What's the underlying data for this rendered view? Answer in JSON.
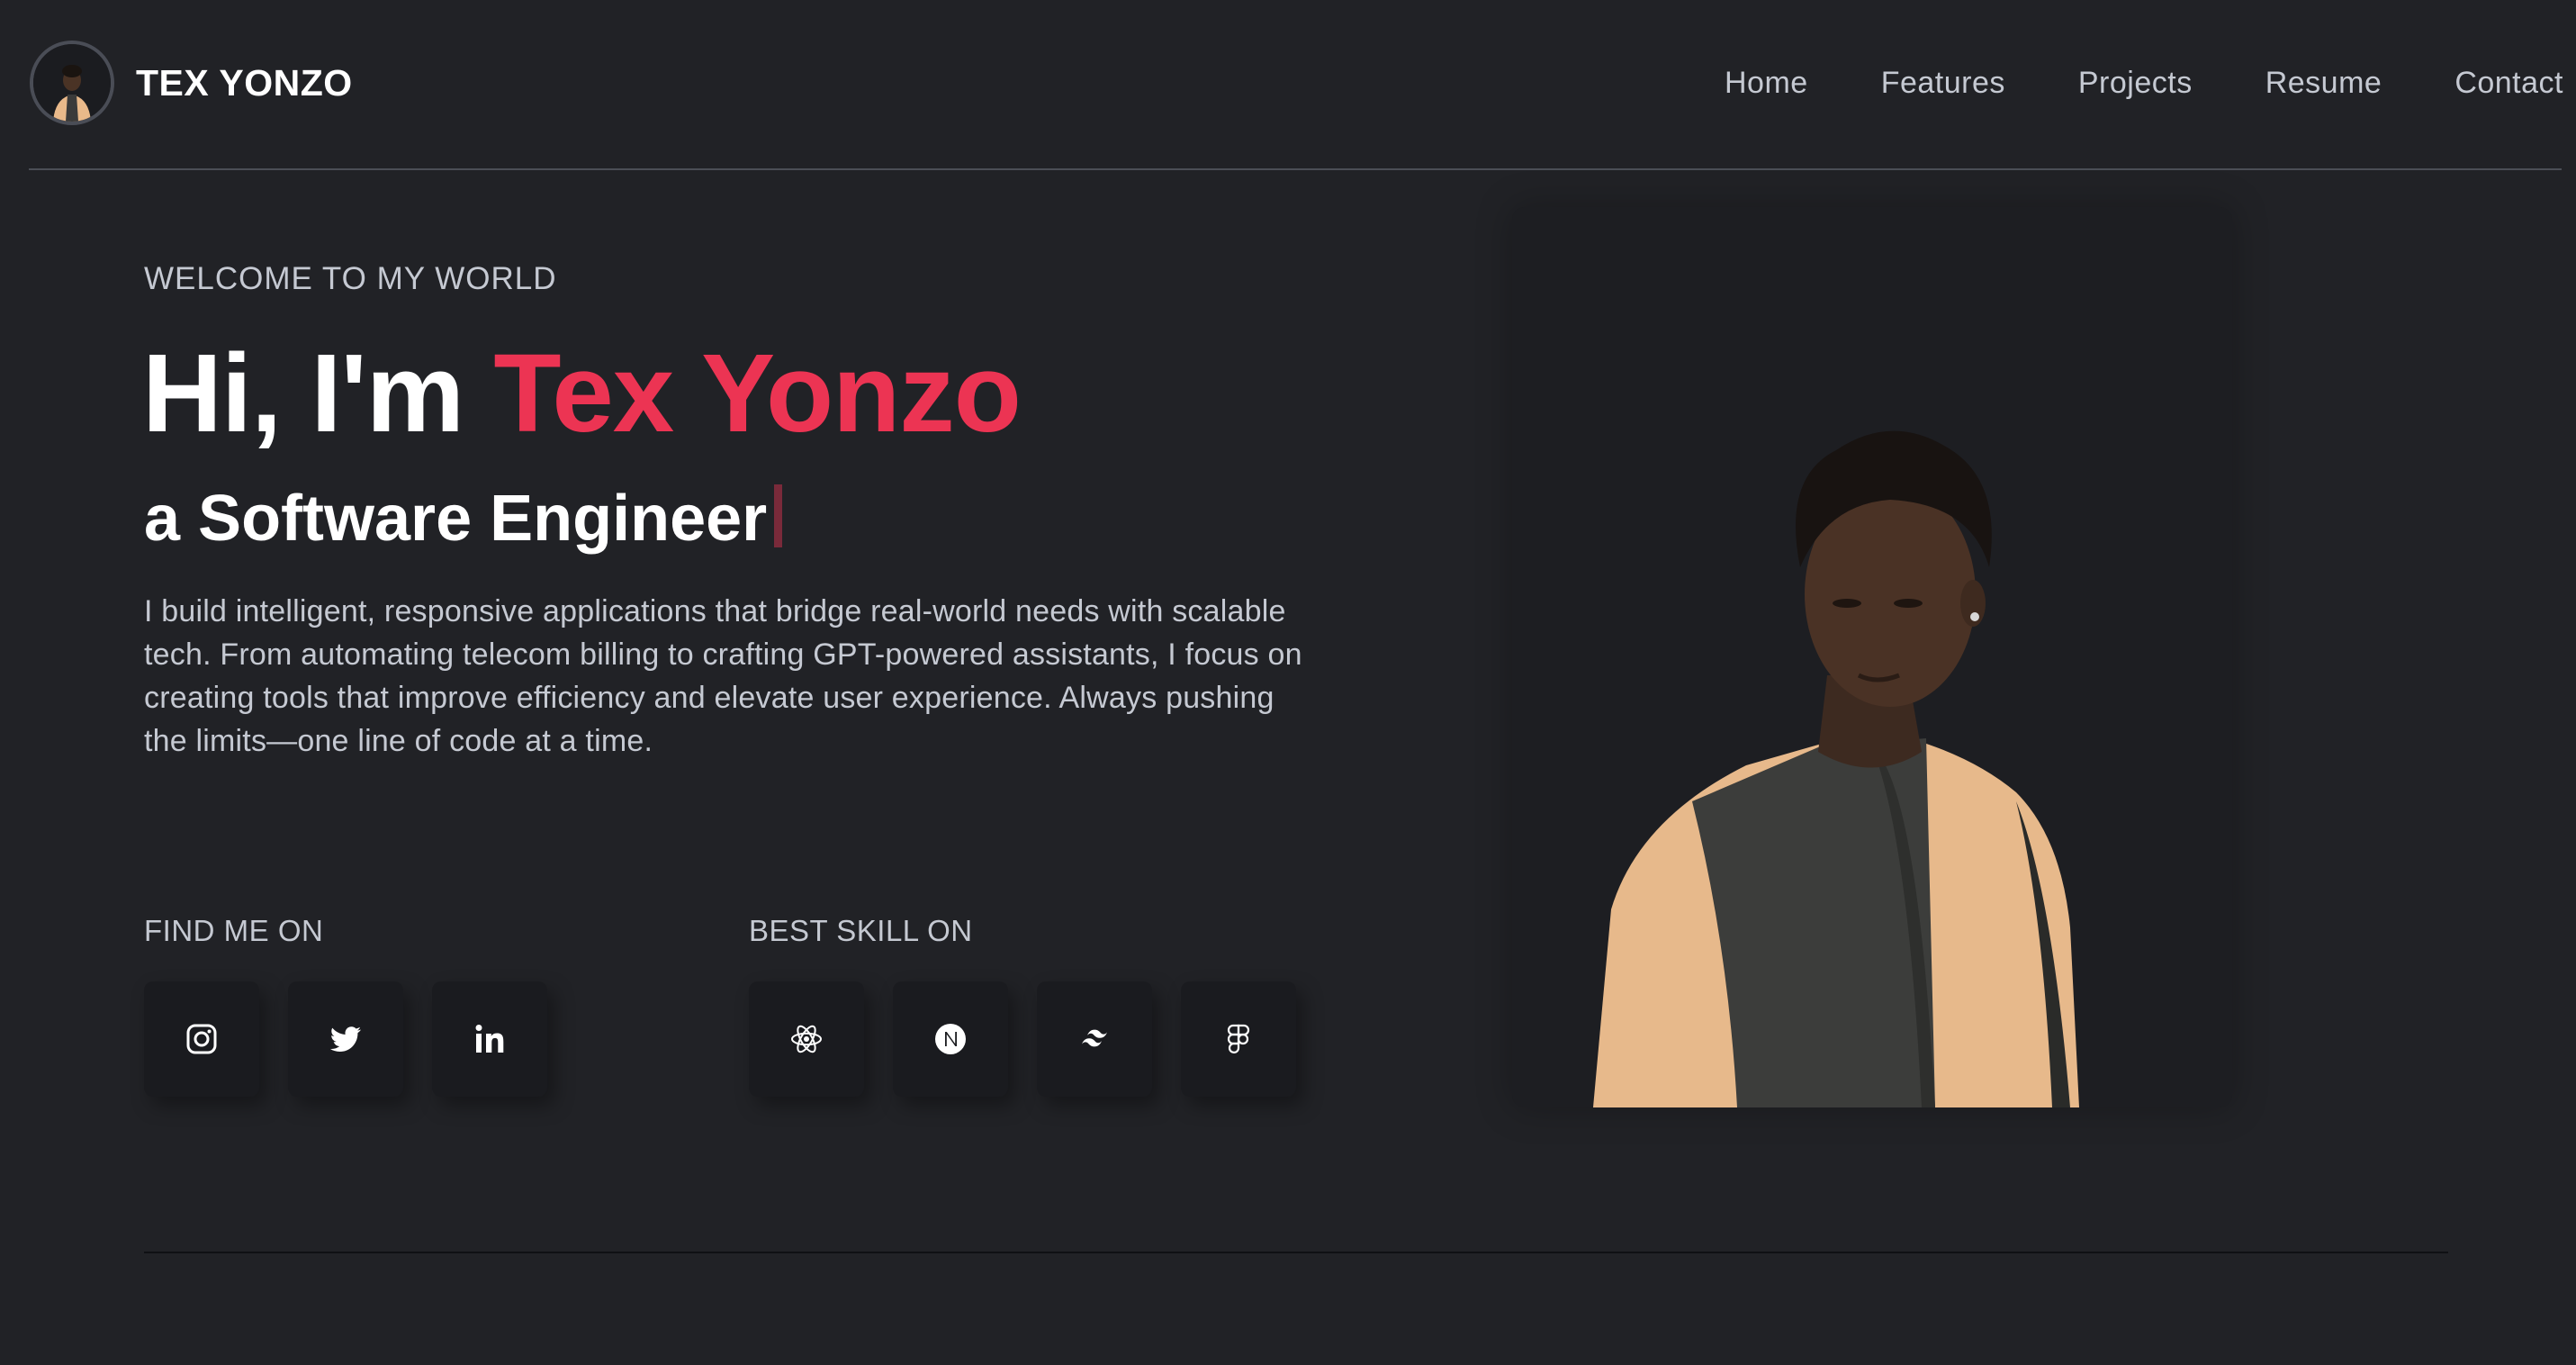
{
  "header": {
    "brand": "TEX YONZO",
    "nav": [
      "Home",
      "Features",
      "Projects",
      "Resume",
      "Contact"
    ]
  },
  "hero": {
    "welcome": "WELCOME TO MY WORLD",
    "greeting": "Hi, I'm ",
    "name": "Tex Yonzo",
    "role": "a Software Engineer",
    "description": "I build intelligent, responsive applications that bridge real-world needs with scalable tech. From automating telecom billing to crafting GPT-powered assistants, I focus on creating tools that improve efficiency and elevate user experience. Always pushing the limits—one line of code at a time."
  },
  "social": {
    "label": "FIND ME ON",
    "icons": [
      "instagram-icon",
      "twitter-icon",
      "linkedin-icon"
    ]
  },
  "skills": {
    "label": "BEST SKILL ON",
    "icons": [
      "react-icon",
      "nextjs-icon",
      "tailwind-icon",
      "figma-icon"
    ]
  },
  "colors": {
    "background": "#212226",
    "accent": "#ec3453",
    "text_muted": "#c5c9d2",
    "card": "#1a1b1f"
  }
}
